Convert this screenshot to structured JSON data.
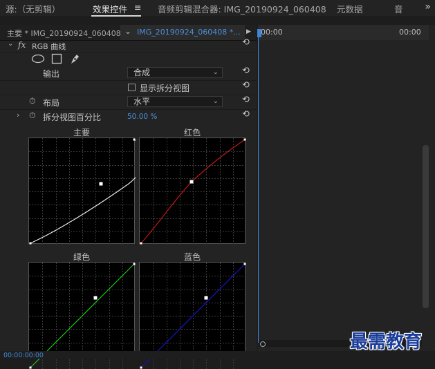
{
  "tabs": {
    "source": "源:（无剪辑）",
    "effect_controls": "效果控件",
    "effect_menu": "≡",
    "audio_mixer": "音频剪辑混合器: IMG_20190924_060408",
    "metadata": "元数据",
    "audio_tail": "音",
    "more": "»"
  },
  "subheader": {
    "master": "主要 * IMG_20190924_060408...",
    "chevron": "⌄",
    "clip": "IMG_20190924_060408 *...",
    "play": "▶",
    "time_start": "00:00",
    "time_end": "00:00"
  },
  "effect": {
    "fx_label": "fx",
    "name": "RGB 曲线",
    "output_label": "输出",
    "output_value": "合成",
    "split_view_label": "显示拆分视图",
    "layout_label": "布局",
    "layout_value": "水平",
    "split_percent_label": "拆分视图百分比",
    "split_percent_value": "50.00 %"
  },
  "curves": {
    "master": "主要",
    "red": "红色",
    "green": "绿色",
    "blue": "蓝色"
  },
  "colors": {
    "master": "#e8e8e8",
    "red": "#c41a1a",
    "green": "#1fc21f",
    "blue": "#1515c8",
    "accent": "#3f86d8"
  },
  "footer": {
    "timecode": "00:00:00:00",
    "watermark": "最需教育"
  }
}
